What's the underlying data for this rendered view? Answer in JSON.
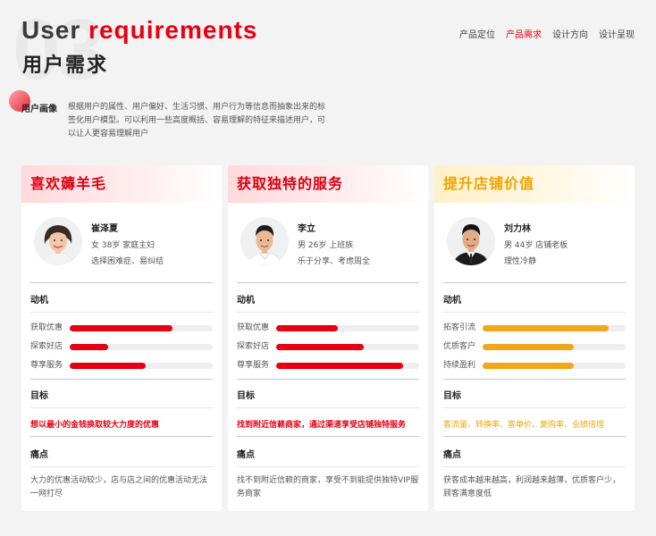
{
  "header": {
    "bg_number": "03",
    "title_en_word1": "User",
    "title_en_word2": "requirements",
    "title_cn": "用户需求"
  },
  "nav": {
    "items": [
      "产品定位",
      "产品需求",
      "设计方向",
      "设计呈现"
    ],
    "active_index": 1
  },
  "persona": {
    "label": "用户画像",
    "description": "根据用户的属性、用户偏好、生活习惯、用户行为等信息而抽象出来的标签化用户模型。可以利用一些高度概括、容易理解的特征来描述用户，可以让人更容易理解用户"
  },
  "colors": {
    "accent_red": "#e60012",
    "accent_yellow": "#f2a71b",
    "background": "#f3f3f3"
  },
  "cards": [
    {
      "title": "喜欢薅羊毛",
      "theme": "red",
      "avatar_icon": "woman-avatar-icon",
      "name": "崔泽夏",
      "info1": "女 38岁 家庭主妇",
      "info2": "选择困难症、易纠结",
      "motivation_title": "动机",
      "bars": [
        {
          "label": "获取优惠",
          "value": 0.72
        },
        {
          "label": "探索好店",
          "value": 0.27
        },
        {
          "label": "尊享服务",
          "value": 0.53
        }
      ],
      "goal_title": "目标",
      "goal": "想以最小的金钱换取较大力度的优惠",
      "pain_title": "痛点",
      "pain": "大力的优惠活动较少，店与店之间的优惠活动无法一网打尽"
    },
    {
      "title": "获取独特的服务",
      "theme": "red",
      "avatar_icon": "young-man-avatar-icon",
      "name": "李立",
      "info1": "男 26岁 上班族",
      "info2": "乐于分享、考虑周全",
      "motivation_title": "动机",
      "bars": [
        {
          "label": "获取优惠",
          "value": 0.43
        },
        {
          "label": "探索好店",
          "value": 0.61
        },
        {
          "label": "尊享服务",
          "value": 0.89
        }
      ],
      "goal_title": "目标",
      "goal": "找到附近信赖商家，通过渠道享受店铺独特服务",
      "pain_title": "痛点",
      "pain": "找不到附近信赖的商家，享受不到能提供独特VIP服务商家"
    },
    {
      "title": "提升店铺价值",
      "theme": "yellow",
      "avatar_icon": "businessman-avatar-icon",
      "name": "刘力林",
      "info1": "男 44岁 店铺老板",
      "info2": "理性冷静",
      "motivation_title": "动机",
      "bars": [
        {
          "label": "拓客引流",
          "value": 0.88
        },
        {
          "label": "优质客户",
          "value": 0.64
        },
        {
          "label": "持续盈利",
          "value": 0.64
        }
      ],
      "goal_title": "目标",
      "goal": "客流量、转换率、客单价、复购率、业绩倍增",
      "pain_title": "痛点",
      "pain": "获客成本越来越高，利润越来越薄，优质客户少，顾客满意度低"
    }
  ]
}
